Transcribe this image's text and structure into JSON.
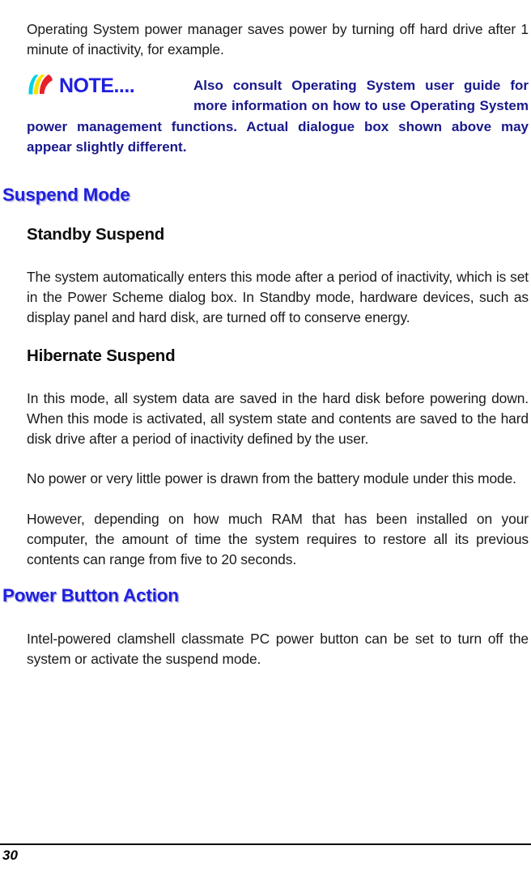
{
  "document": {
    "page_number": "30"
  },
  "content": {
    "intro_paragraph": "Operating System power manager saves power by turning off hard drive after 1 minute of inactivity, for example.",
    "note": {
      "logo_text": "NOTE....",
      "logo_icon": "note-swoosh-icon",
      "text": "Also consult Operating System user guide for more information on how to use Operating System power management functions. Actual dialogue box shown above may appear slightly different."
    },
    "sections": [
      {
        "heading": "Suspend Mode",
        "subsections": [
          {
            "heading": "Standby Suspend",
            "paragraphs": [
              "The system automatically enters this mode after a period of inactivity, which is set in the Power Scheme dialog box. In Standby mode, hardware devices, such as display panel and hard disk, are turned off to conserve energy."
            ]
          },
          {
            "heading": "Hibernate Suspend",
            "paragraphs": [
              "In this mode, all system data are saved in the hard disk before powering down. When this mode is activated, all system state and contents are saved to the hard disk drive after a period of inactivity defined by the user.",
              "No power or very little power is drawn from the battery module under this mode.",
              "However, depending on how much RAM that has been installed on your computer, the amount of time the system requires to restore all its previous contents can range from five to 20 seconds."
            ]
          }
        ]
      },
      {
        "heading": "Power Button Action",
        "subsections": [
          {
            "heading": "",
            "paragraphs": [
              "Intel-powered clamshell classmate PC power button can be set to turn off the system or activate the suspend mode."
            ]
          }
        ]
      }
    ]
  },
  "colors": {
    "section_heading": "#1f1fe0",
    "note_text": "#19198c",
    "note_logo": "#1f1fe0",
    "body_text": "#1a1a1a",
    "swoosh_cyan": "#00d2e6",
    "swoosh_yellow": "#ffe000",
    "swoosh_red": "#e8202a"
  }
}
